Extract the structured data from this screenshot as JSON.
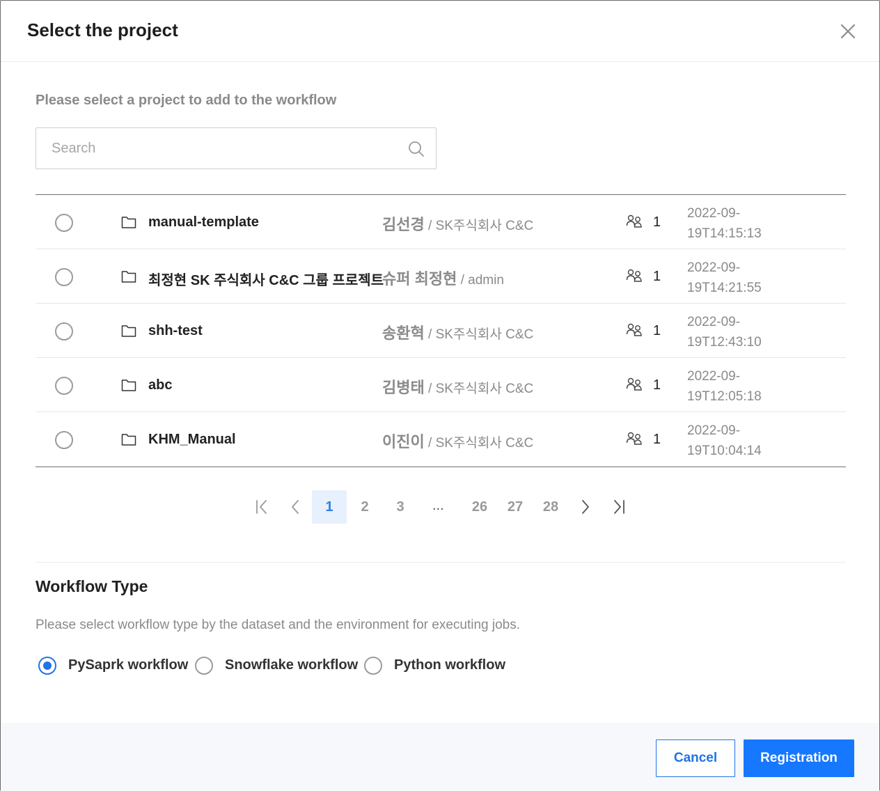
{
  "dialog": {
    "title": "Select the project",
    "subtitle": "Please select a project to add to the workflow"
  },
  "search": {
    "placeholder": "Search",
    "value": ""
  },
  "projects": [
    {
      "name": "manual-template",
      "owner": "김선경",
      "org": " / SK주식회사 C&C",
      "members": "1",
      "date_line1": "2022-09-",
      "date_line2": "19T14:15:13"
    },
    {
      "name": "최정현 SK 주식회사 C&C 그룹 프로젝트",
      "owner": "슈퍼 최정현",
      "org": " / admin",
      "members": "1",
      "date_line1": "2022-09-",
      "date_line2": "19T14:21:55"
    },
    {
      "name": "shh-test",
      "owner": "송환혁",
      "org": " / SK주식회사 C&C",
      "members": "1",
      "date_line1": "2022-09-",
      "date_line2": "19T12:43:10"
    },
    {
      "name": "abc",
      "owner": "김병태",
      "org": " / SK주식회사 C&C",
      "members": "1",
      "date_line1": "2022-09-",
      "date_line2": "19T12:05:18"
    },
    {
      "name": "KHM_Manual",
      "owner": "이진이",
      "org": " / SK주식회사 C&C",
      "members": "1",
      "date_line1": "2022-09-",
      "date_line2": "19T10:04:14"
    }
  ],
  "pagination": {
    "pages": [
      "1",
      "2",
      "3",
      "26",
      "27",
      "28"
    ],
    "ellipsis": "...",
    "current": "1"
  },
  "workflow_type": {
    "title": "Workflow Type",
    "description": "Please select workflow type by the dataset and the environment for executing jobs.",
    "options": [
      {
        "label": "PySaprk workflow",
        "selected": true
      },
      {
        "label": "Snowflake workflow",
        "selected": false
      },
      {
        "label": "Python workflow",
        "selected": false
      }
    ]
  },
  "footer": {
    "cancel_label": "Cancel",
    "register_label": "Registration"
  },
  "colors": {
    "accent": "#1677ff",
    "active_page_bg": "#e7f1fd",
    "muted_text": "#8a8a8a"
  }
}
